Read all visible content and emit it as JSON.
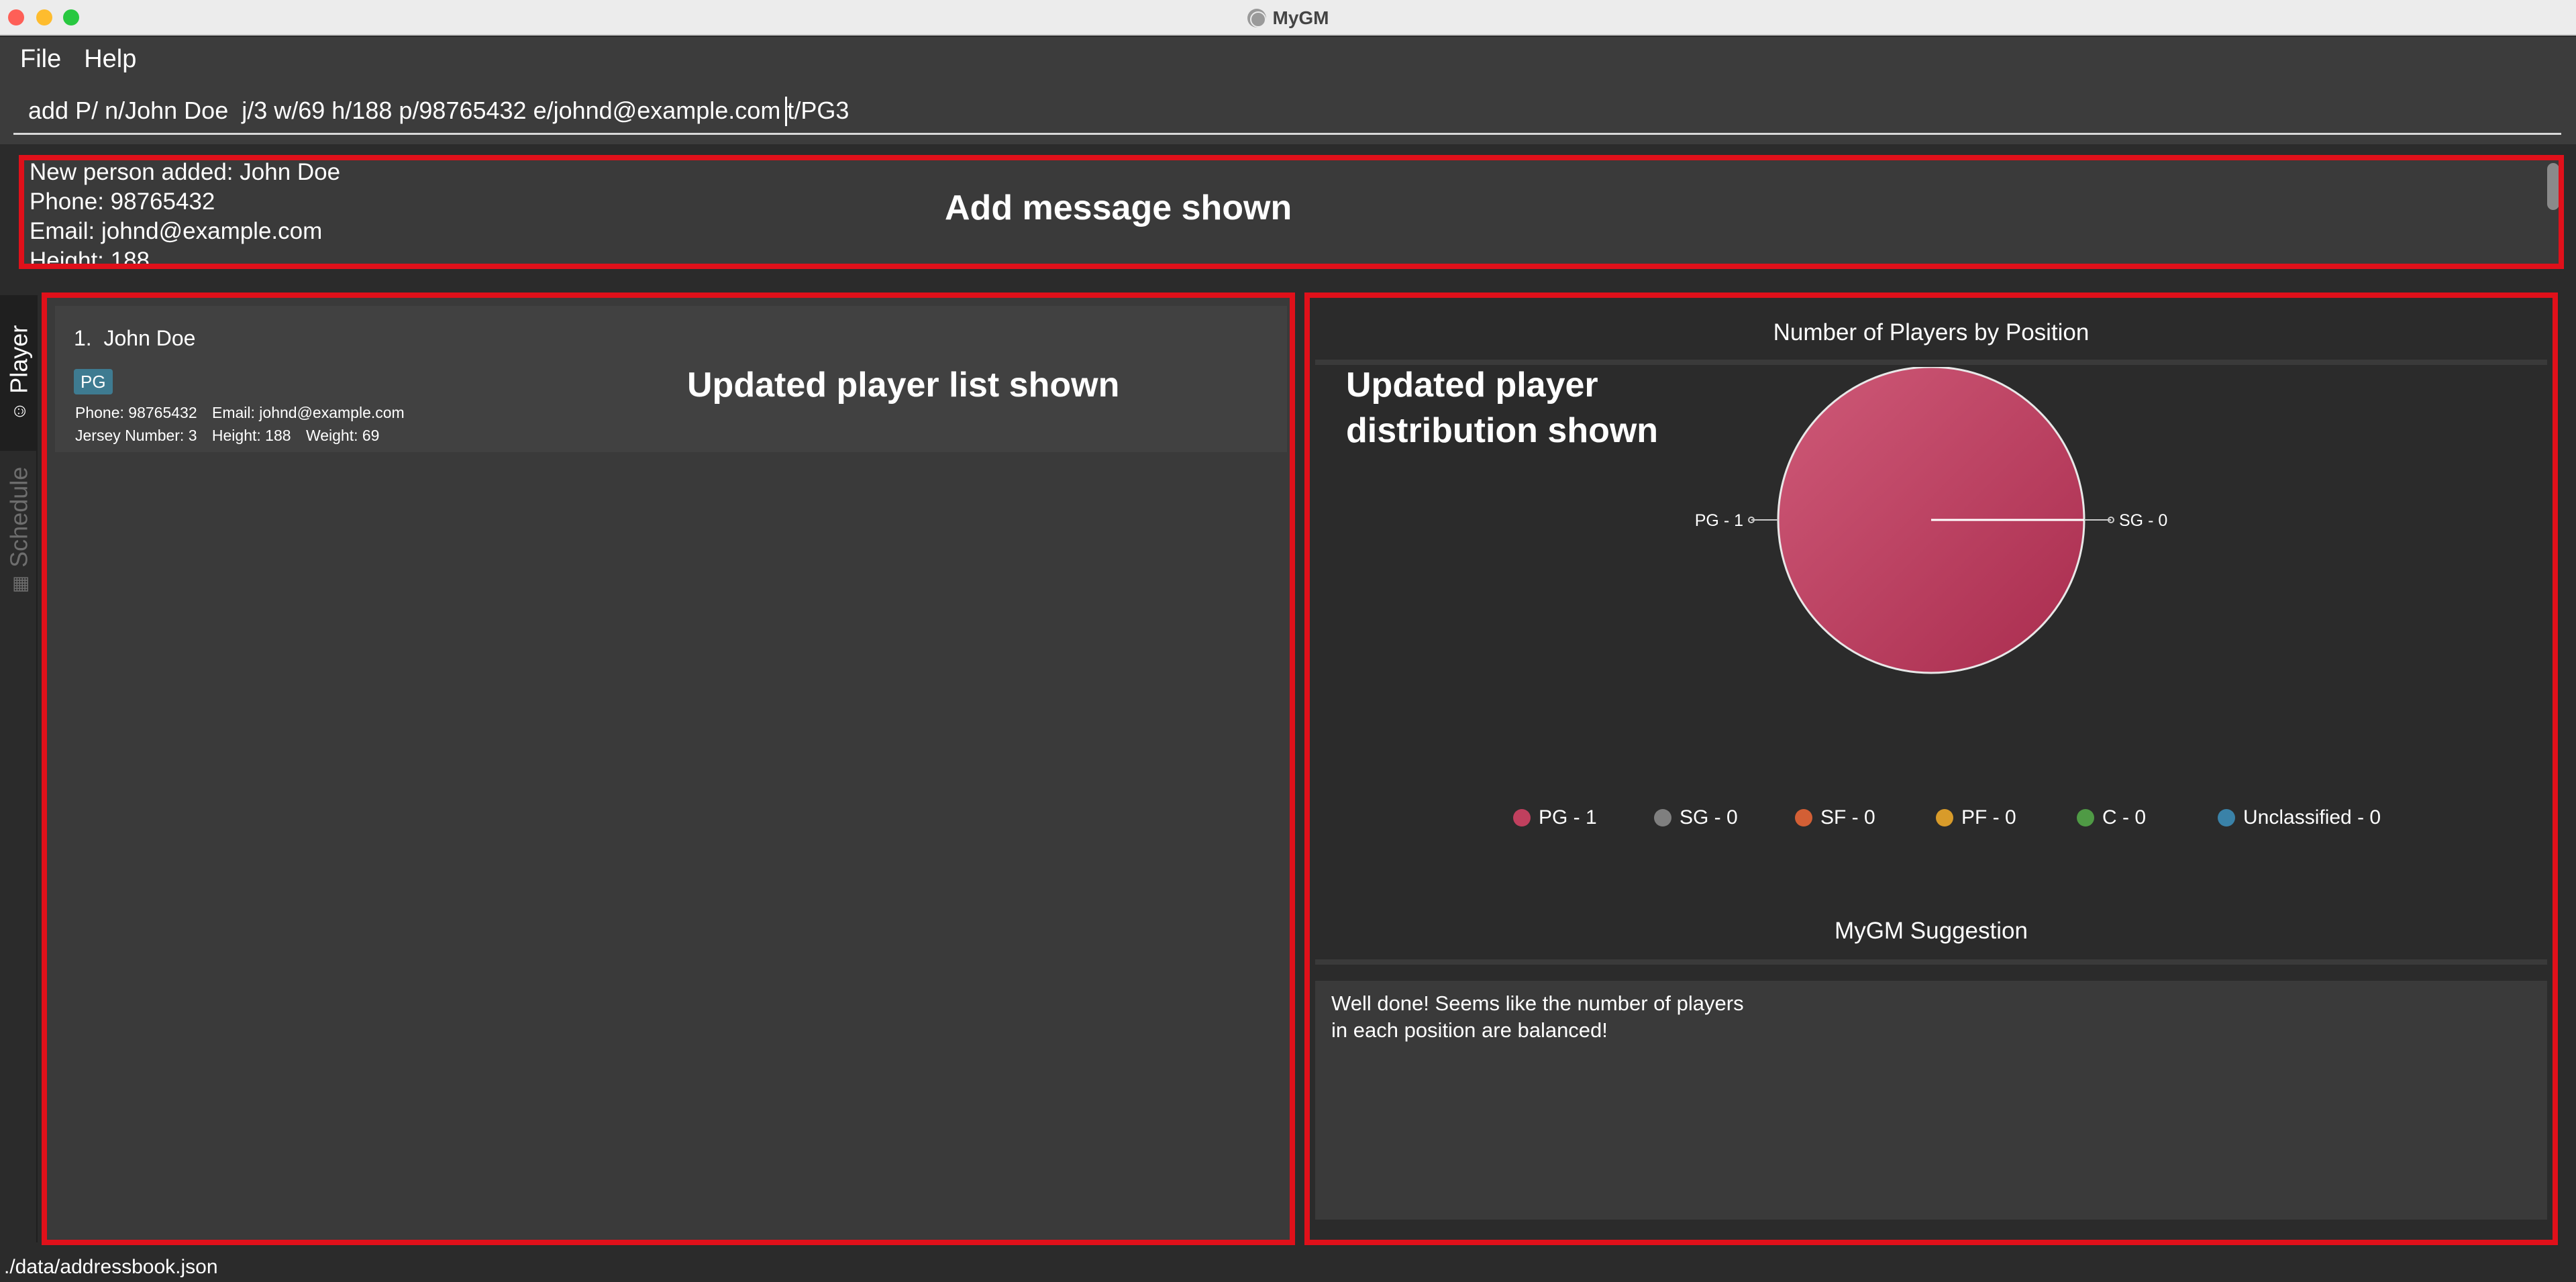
{
  "window": {
    "title": "MyGM"
  },
  "menu": {
    "items": [
      "File",
      "Help"
    ]
  },
  "command": {
    "value": "add P/ n/John Doe  j/3 w/69 h/188 p/98765432 e/johnd@example.com t/PG3"
  },
  "result": {
    "lines": [
      "New person added: John Doe",
      "Phone: 98765432",
      "Email: johnd@example.com",
      "Height: 188"
    ]
  },
  "tabs": {
    "player": "Player",
    "schedule": "Schedule"
  },
  "players": [
    {
      "index": "1.",
      "name": "John Doe",
      "tag": "PG",
      "phone": "Phone: 98765432",
      "email": "Email: johnd@example.com",
      "jersey": "Jersey Number: 3",
      "height": "Height: 188",
      "weight": "Weight: 69"
    }
  ],
  "annotations": {
    "message": "Add message shown",
    "list": "Updated player list shown",
    "distribution": "Updated player\ndistribution shown"
  },
  "chart_data": {
    "type": "pie",
    "title": "Number of Players by Position",
    "categories": [
      "PG",
      "SG",
      "SF",
      "PF",
      "C",
      "Unclassified"
    ],
    "values": [
      1,
      0,
      0,
      0,
      0,
      0
    ],
    "slice_labels": [
      "PG - 1",
      "SG - 0"
    ],
    "legend": [
      "PG - 1",
      "SG - 0",
      "SF - 0",
      "PF - 0",
      "C - 0",
      "Unclassified - 0"
    ],
    "legend_position": "bottom",
    "colors": {
      "PG": "#c0405e",
      "SG": "#7f7f7f",
      "SF": "#d35f35",
      "PF": "#d89b2a",
      "C": "#4f9a45",
      "Unclassified": "#3a82a8"
    }
  },
  "suggestion": {
    "title": "MyGM Suggestion",
    "text": "Well done! Seems like the number of players\nin each position are balanced!"
  },
  "status": {
    "path": "./data/addressbook.json"
  },
  "colors": {
    "annotation": "#e0101a",
    "panel": "#3a3a3a",
    "background": "#2b2b2b"
  }
}
